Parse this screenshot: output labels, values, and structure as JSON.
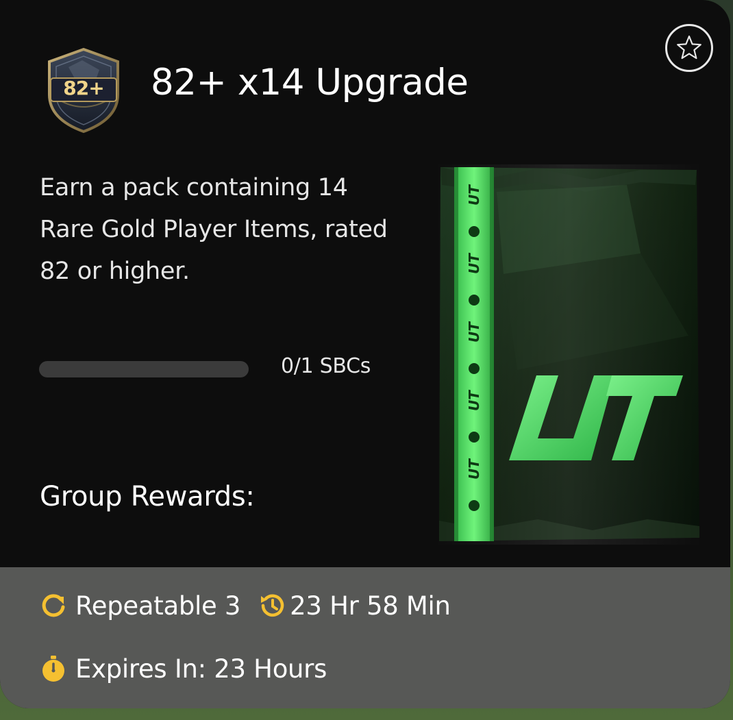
{
  "sbc": {
    "badge_text": "82+",
    "title": "82+ x14 Upgrade",
    "description": "Earn a pack containing 14 Rare Gold Player Items, rated 82 or higher.",
    "progress": {
      "text": "0/1 SBCs",
      "completed": 0,
      "total": 1,
      "fraction": 0
    },
    "group_rewards_label": "Group Rewards:",
    "pack": {
      "logo_text": "UT",
      "band_text": "UT",
      "accent_color": "#4fd65a"
    }
  },
  "footer": {
    "repeatable": "Repeatable 3",
    "refresh_timer": "23 Hr 58 Min",
    "expires": "Expires In: 23 Hours",
    "icon_color": "#f5c031"
  },
  "icons": {
    "favorite": "star-icon",
    "repeat": "repeat-icon",
    "refresh": "history-clock-icon",
    "expiry": "stopwatch-icon"
  }
}
